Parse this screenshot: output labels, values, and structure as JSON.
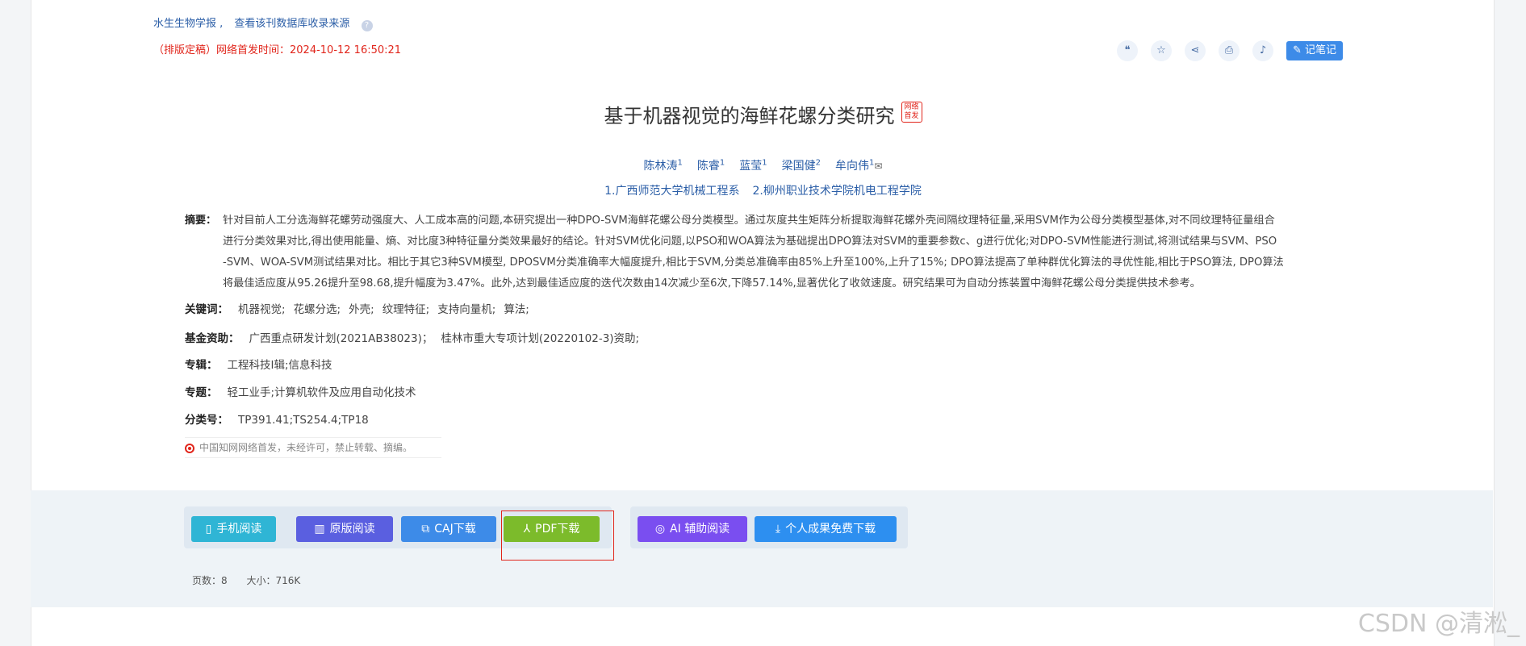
{
  "header": {
    "journal": "水生生物学报 ,",
    "source_link": "查看该刊数据库收录来源",
    "help_icon": "?",
    "pubtime": "（排版定稿）网络首发时间：2024-10-12 16:50:21"
  },
  "toolbar": {
    "icons": [
      "quote-icon",
      "star-icon",
      "share-icon",
      "print-icon",
      "bell-icon"
    ],
    "note_label": "记笔记"
  },
  "article": {
    "title": "基于机器视觉的海鲜花螺分类研究",
    "badge": "网络首发",
    "authors": [
      {
        "name": "陈林涛",
        "sup": "1"
      },
      {
        "name": "陈睿",
        "sup": "1"
      },
      {
        "name": "蓝莹",
        "sup": "1"
      },
      {
        "name": "梁国健",
        "sup": "2"
      },
      {
        "name": "牟向伟",
        "sup": "1"
      }
    ],
    "affiliations": [
      "1.广西师范大学机械工程系",
      "2.柳州职业技术学院机电工程学院"
    ],
    "abstract_label": "摘要：",
    "abstract_lines": [
      "针对目前人工分选海鲜花螺劳动强度大、人工成本高的问题,本研究提出一种DPO-SVM海鲜花螺公母分类模型。通过灰度共生矩阵分析提取海鲜花螺外壳间隔纹理特征量,采用SVM作为公母分类模型基体,对不同纹理特征量组合",
      "进行分类效果对比,得出使用能量、熵、对比度3种特征量分类效果最好的结论。针对SVM优化问题,以PSO和WOA算法为基础提出DPO算法对SVM的重要参数c、g进行优化;对DPO-SVM性能进行测试,将测试结果与SVM、PSO",
      "-SVM、WOA-SVM测试结果对比。相比于其它3种SVM模型, DPOSVM分类准确率大幅度提升,相比于SVM,分类总准确率由85%上升至100%,上升了15%; DPO算法提高了单种群优化算法的寻优性能,相比于PSO算法, DPO算法",
      "将最佳适应度从95.26提升至98.68,提升幅度为3.47%。此外,达到最佳适应度的迭代次数由14次减少至6次,下降57.14%,显著优化了收敛速度。研究结果可为自动分拣装置中海鲜花螺公母分类提供技术参考。"
    ],
    "keywords_label": "关键词：",
    "keywords": [
      "机器视觉;",
      "花螺分选;",
      "外壳;",
      "纹理特征;",
      "支持向量机;",
      "算法;"
    ],
    "fund_label": "基金资助：",
    "funds": [
      "广西重点研发计划(2021AB38023)；",
      "桂林市重大专项计划(20220102-3)资助;"
    ],
    "series_label": "专辑：",
    "series": "工程科技Ⅰ辑;信息科技",
    "topic_label": "专题：",
    "topic": "轻工业手;计算机软件及应用自动化技术",
    "class_label": "分类号：",
    "class_no": "TP391.41;TS254.4;TP18",
    "copyright": "中国知网网络首发，未经许可，禁止转载、摘编。"
  },
  "downloads": {
    "group1": [
      {
        "label": "手机阅读",
        "icon": "phone-icon",
        "color": "#2fb5d5"
      },
      {
        "label": "原版阅读",
        "icon": "book-icon",
        "color": "#5a5fe0"
      },
      {
        "label": "CAJ下载",
        "icon": "open-book-icon",
        "color": "#3d8be8"
      },
      {
        "label": "PDF下载",
        "icon": "pdf-icon",
        "color": "#7cbb2b"
      }
    ],
    "group2": [
      {
        "label": "AI 辅助阅读",
        "icon": "ai-icon",
        "color": "#7a4ef0"
      },
      {
        "label": "个人成果免费下载",
        "icon": "download-icon",
        "color": "#2d8ff0"
      }
    ],
    "pages_label": "页数：8",
    "size_label": "大小：716K"
  },
  "watermark": "CSDN @清淞_"
}
